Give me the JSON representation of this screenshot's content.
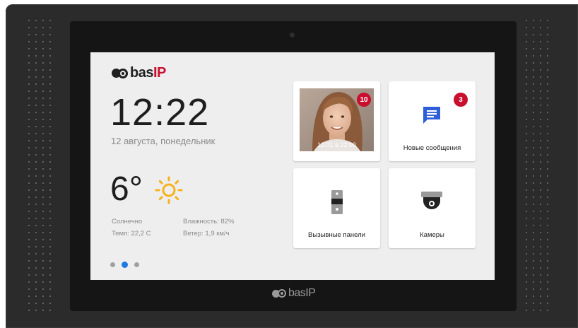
{
  "brand": {
    "name_prefix": "bas",
    "name_suffix": "IP",
    "accent": "#c8102e"
  },
  "time": "12:22",
  "date": "12 августа, понедельник",
  "weather": {
    "temperature": "6°",
    "icon": "sun-icon",
    "condition": "Солнечно",
    "humidity": "Влажность: 82%",
    "temp_detail": "Темп: 22,2 С",
    "wind": "Ветер: 1,9 км/ч"
  },
  "pager": {
    "pages": 3,
    "active": 2,
    "active_color": "#1f7ae0",
    "inactive_color": "#a0a0a0"
  },
  "tiles": {
    "visitors": {
      "badge": "10",
      "timestamp": "12.01 в 22:00"
    },
    "messages": {
      "label": "Новые сообщения",
      "badge": "3",
      "icon": "message-icon",
      "icon_color": "#2f5fd8"
    },
    "panels": {
      "label": "Вызывные панели",
      "icon": "door-panel-icon"
    },
    "cameras": {
      "label": "Камеры",
      "icon": "dome-camera-icon"
    }
  }
}
